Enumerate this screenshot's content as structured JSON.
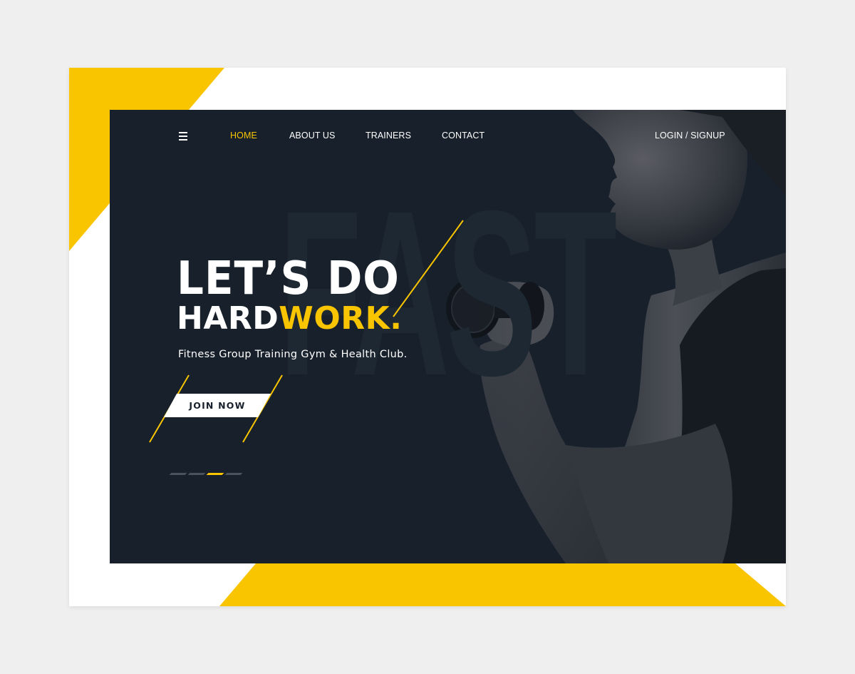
{
  "colors": {
    "accent": "#f9c400",
    "hero_bg": "#17202b",
    "page_bg": "#efefef",
    "white": "#ffffff"
  },
  "nav": {
    "menu_icon": "hamburger-menu-icon",
    "items": [
      {
        "label": "HOME",
        "active": true
      },
      {
        "label": "ABOUT US",
        "active": false
      },
      {
        "label": "TRAINERS",
        "active": false
      },
      {
        "label": "CONTACT",
        "active": false
      }
    ],
    "auth_label": "LOGIN / SIGNUP"
  },
  "hero": {
    "watermark": "FAST",
    "headline_line1": "LET’S DO",
    "headline_line2_plain": "HARD",
    "headline_line2_accent": "WORK.",
    "tagline": "Fitness Group Training Gym & Health Club.",
    "cta_label": "JOIN NOW",
    "image_subject": "woman-lifting-dumbbell-photo"
  },
  "slider": {
    "count": 4,
    "active_index": 2
  }
}
